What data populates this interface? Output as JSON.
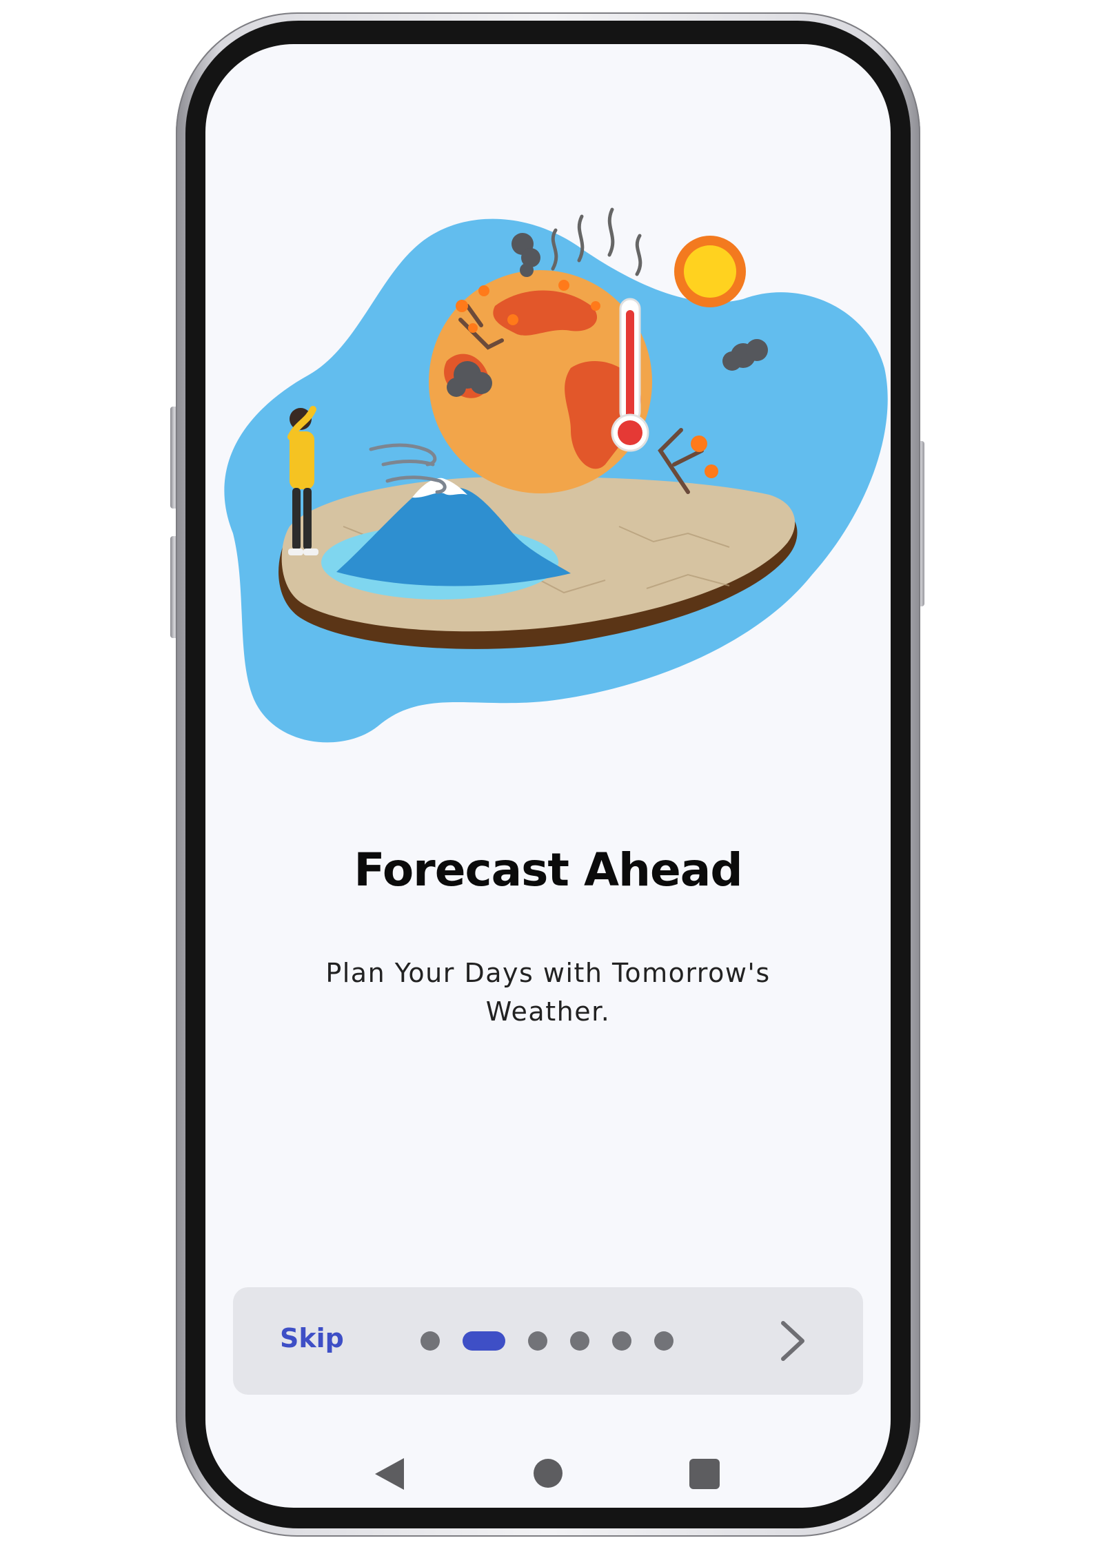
{
  "onboarding": {
    "title": "Forecast Ahead",
    "subtitle": "Plan Your Days with Tomorrow's Weather."
  },
  "pager": {
    "skip_label": "Skip",
    "page_count": 6,
    "active_index": 1,
    "next_icon": "chevron-right-icon"
  },
  "nav_bar": {
    "back_icon": "nav-back-icon",
    "home_icon": "nav-home-icon",
    "recents_icon": "nav-recents-icon"
  },
  "colors": {
    "accent": "#3e4fc6",
    "screen_background": "#f7f8fc",
    "pager_background": "#e4e5ea",
    "hero_blob": "#62bdee",
    "inactive_dot": "#727378"
  }
}
